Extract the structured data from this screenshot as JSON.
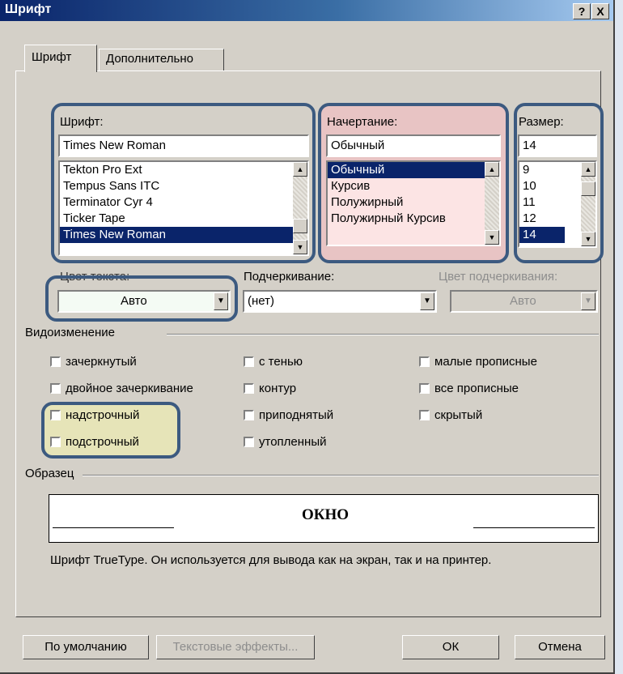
{
  "title": "Шрифт",
  "title_buttons": {
    "help": "?",
    "close": "X"
  },
  "tabs": [
    {
      "label": "Шрифт"
    },
    {
      "label": "Дополнительно"
    }
  ],
  "font": {
    "label": "Шрифт:",
    "value": "Times New Roman",
    "items": [
      "Tekton Pro Ext",
      "Tempus Sans ITC",
      "Terminator Cyr 4",
      "Ticker Tape",
      "Times New Roman"
    ],
    "selected": "Times New Roman"
  },
  "style": {
    "label": "Начертание:",
    "value": "Обычный",
    "items": [
      "Обычный",
      "Курсив",
      "Полужирный",
      "Полужирный Курсив"
    ],
    "selected": "Обычный"
  },
  "size": {
    "label": "Размер:",
    "value": "14",
    "items": [
      "9",
      "10",
      "11",
      "12",
      "14"
    ],
    "selected": "14"
  },
  "text_color": {
    "label": "Цвет текста:",
    "value": "Авто"
  },
  "underline": {
    "label": "Подчеркивание:",
    "value": "(нет)"
  },
  "underline_color": {
    "label": "Цвет подчеркивания:",
    "value": "Авто"
  },
  "effects": {
    "label": "Видоизменение",
    "col1": [
      "зачеркнутый",
      "двойное зачеркивание",
      "надстрочный",
      "подстрочный"
    ],
    "col2": [
      "с тенью",
      "контур",
      "приподнятый",
      "утопленный"
    ],
    "col3": [
      "малые прописные",
      "все прописные",
      "скрытый"
    ]
  },
  "sample": {
    "label": "Образец",
    "text": "ОКНО",
    "description": "Шрифт TrueType. Он используется для вывода как на экран, так и на принтер."
  },
  "buttons": {
    "default": "По умолчанию",
    "text_effects": "Текстовые эффекты...",
    "ok": "ОК",
    "cancel": "Отмена"
  },
  "colors": {
    "accent_outline": "#3c5a80",
    "style_highlight": "#e8c4c4",
    "effects_highlight": "#e6e4b8",
    "selection": "#0a246a"
  }
}
